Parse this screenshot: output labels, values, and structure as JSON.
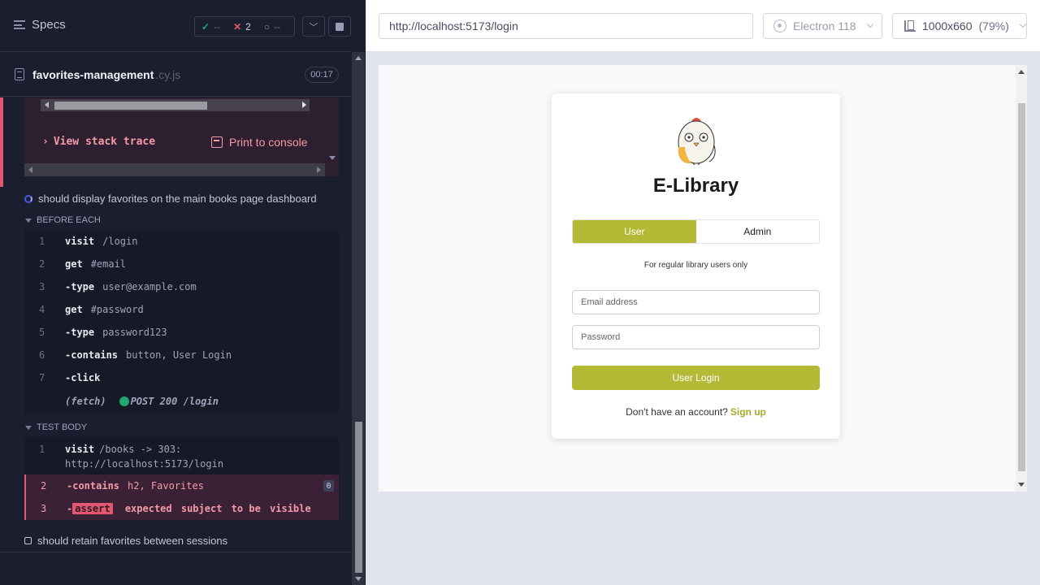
{
  "reporter": {
    "header": {
      "specs_label": "Specs",
      "passed_count": "--",
      "failed_count": "2",
      "pending_count": "--"
    },
    "spec": {
      "name": "favorites-management",
      "ext": ".cy.js",
      "duration": "00:17"
    },
    "error": {
      "stack_trace_label": "View stack trace",
      "print_label": "Print to console"
    },
    "running_test": {
      "title": "should display favorites on the main books page dashboard",
      "before_each_label": "BEFORE EACH",
      "before_each": [
        {
          "num": "1",
          "name": "visit",
          "arg": "/login"
        },
        {
          "num": "2",
          "name": "get",
          "arg": "#email"
        },
        {
          "num": "3",
          "name": "-type",
          "arg": "user@example.com"
        },
        {
          "num": "4",
          "name": "get",
          "arg": "#password"
        },
        {
          "num": "5",
          "name": "-type",
          "arg": "password123"
        },
        {
          "num": "6",
          "name": "-contains",
          "arg": "button, User Login"
        },
        {
          "num": "7",
          "name": "-click",
          "arg": ""
        }
      ],
      "fetch": {
        "label": "(fetch)",
        "value": "POST 200 /login"
      },
      "test_body_label": "TEST BODY",
      "test_body": {
        "cmd1": {
          "num": "1",
          "name": "visit",
          "arg": "/books -> 303:",
          "arg2": "http://localhost:5173/login"
        },
        "cmd2": {
          "num": "2",
          "name": "-contains",
          "arg": "h2, Favorites",
          "badge": "0"
        },
        "cmd3": {
          "num": "3",
          "dash": "-",
          "tag": "assert",
          "w1": "expected",
          "w2": "subject",
          "w3": "to be",
          "w4": "visible"
        }
      }
    },
    "next_test": {
      "title": "should retain favorites between sessions"
    }
  },
  "aut": {
    "url": "http://localhost:5173/login",
    "browser": "Electron 118",
    "viewport": "1000x660",
    "zoom": "(79%)",
    "app": {
      "brand": "E-Library",
      "tabs": {
        "user": "User",
        "admin": "Admin"
      },
      "note": "For regular library users only",
      "email_placeholder": "Email address",
      "password_placeholder": "Password",
      "login_button": "User Login",
      "signup_prompt": "Don't have an account?",
      "signup_link": "Sign up"
    }
  },
  "colors": {
    "accent": "#b4ba36",
    "fail": "#e45770",
    "pass": "#1fa971",
    "reporter_bg": "#1b1e2e"
  }
}
